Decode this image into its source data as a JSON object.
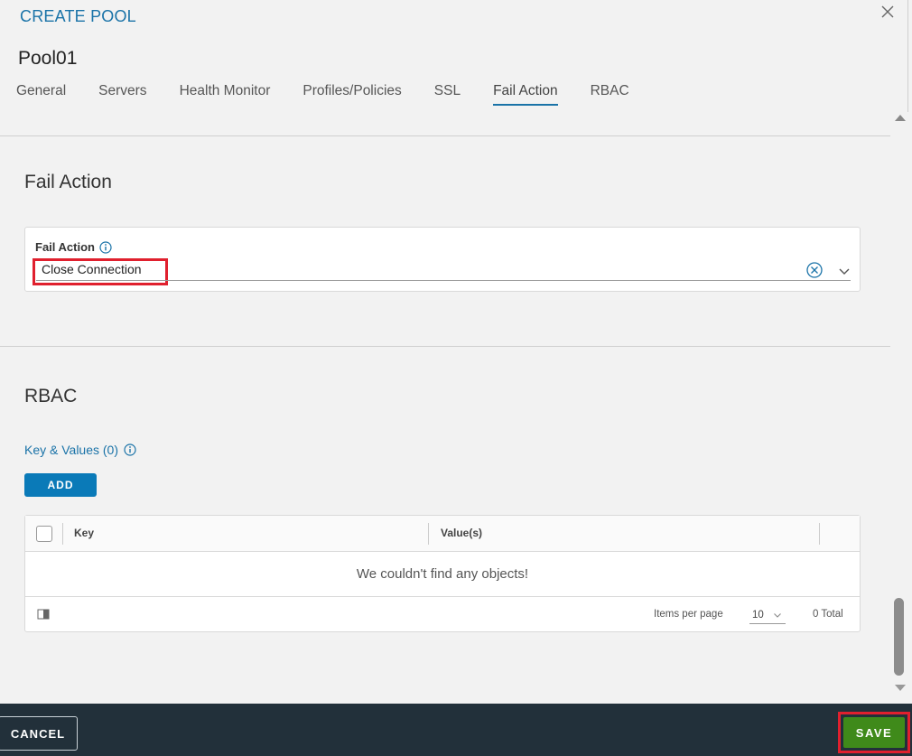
{
  "modal": {
    "title": "CREATE POOL",
    "pool_name": "Pool01"
  },
  "tabs": [
    {
      "label": "General"
    },
    {
      "label": "Servers"
    },
    {
      "label": "Health Monitor"
    },
    {
      "label": "Profiles/Policies"
    },
    {
      "label": "SSL"
    },
    {
      "label": "Fail Action",
      "active": true
    },
    {
      "label": "RBAC"
    }
  ],
  "fail_action": {
    "section_title": "Fail Action",
    "field_label": "Fail Action",
    "field_value": "Close Connection"
  },
  "rbac": {
    "section_title": "RBAC",
    "kv_label": "Key & Values (0)",
    "add_label": "ADD",
    "grid": {
      "columns": [
        "Key",
        "Value(s)"
      ],
      "empty_message": "We couldn't find any objects!",
      "items_per_page_label": "Items per page",
      "items_per_page_value": "10",
      "total_label": "0 Total"
    }
  },
  "footer": {
    "cancel_label": "CANCEL",
    "save_label": "SAVE"
  },
  "colors": {
    "accent": "#1a73a8",
    "add_button": "#0a7ab8",
    "save_button": "#3f8a1a",
    "footer_bg": "#22303a",
    "highlight": "#e0202e"
  },
  "icons": {
    "close": "close-icon",
    "info": "info-icon",
    "clear": "clear-circle-icon",
    "dropdown": "chevron-down-icon",
    "column_toggle": "column-toggle-icon"
  }
}
